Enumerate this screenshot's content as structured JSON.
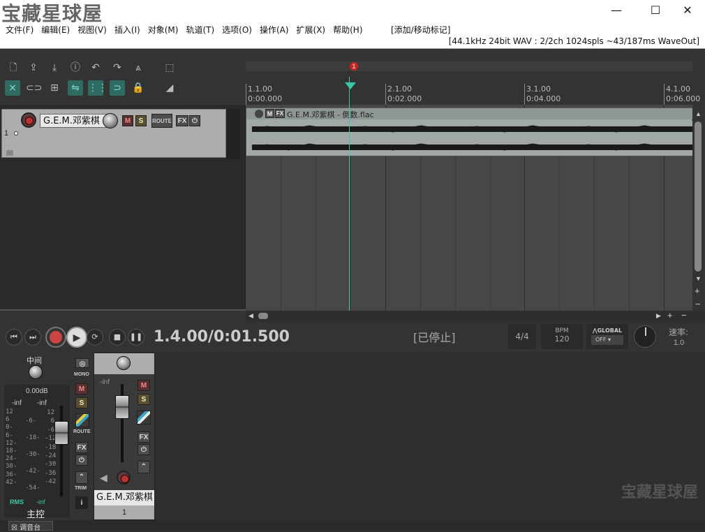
{
  "titlebar": {
    "watermark": "宝藏星球屋",
    "minimize": "—",
    "maximize": "☐",
    "close": "✕"
  },
  "menu": {
    "items": [
      "文件(F)",
      "编辑(E)",
      "视图(V)",
      "插入(I)",
      "对象(M)",
      "轨道(T)",
      "选项(O)",
      "操作(A)",
      "扩展(X)",
      "帮助(H)"
    ],
    "action": "[添加/移动标记]"
  },
  "status_info": "[44.1kHz 24bit WAV : 2/2ch 1024spls ~43/187ms WaveOut]",
  "ruler": {
    "marks": [
      {
        "bar": "1.1.00",
        "time": "0:00.000"
      },
      {
        "bar": "2.1.00",
        "time": "0:02.000"
      },
      {
        "bar": "3.1.00",
        "time": "0:04.000"
      },
      {
        "bar": "4.1.00",
        "time": "0:06.000"
      }
    ],
    "marker": "1"
  },
  "track": {
    "number": "1",
    "name": "G.E.M.邓紫棋",
    "mute": "M",
    "solo": "S",
    "route": "ROUTE",
    "fx": "FX"
  },
  "item": {
    "title": "G.E.M.邓紫棋 - 倒数.flac",
    "m": "M",
    "fx": "FX"
  },
  "transport": {
    "position": "1.4.00/0:01.500",
    "state": "[已停止]",
    "timesig": "4/4",
    "bpm_label": "BPM",
    "bpm": "120",
    "global_label": "GLOBAL",
    "global_value": "OFF",
    "rate_label": "速率:",
    "rate": "1.0"
  },
  "master": {
    "pan_label": "中间",
    "volume": "0.00dB",
    "peak_l": "-inf",
    "peak_r": "-inf",
    "scale_left": [
      "12",
      "6",
      "0-",
      "6-",
      "12-",
      "18-",
      "24-",
      "30-",
      "36-",
      "42-"
    ],
    "scale_mid": [
      "-6-",
      "-18-",
      "-30-",
      "-42-",
      "-54-"
    ],
    "scale_right": [
      "12",
      "6",
      "-6",
      "-12",
      "-18",
      "-24",
      "-30",
      "-36",
      "-42"
    ],
    "rms": "RMS",
    "rms_val": "-inf",
    "name": "主控",
    "mono": "MONO",
    "m": "M",
    "s": "S",
    "route": "ROUTE",
    "fx": "FX",
    "trim": "TRIM",
    "info": "i"
  },
  "channel": {
    "peak": "-inf",
    "m": "M",
    "s": "S",
    "fx": "FX",
    "name": "G.E.M.邓紫棋",
    "number": "1"
  },
  "bottom": {
    "tab": "调音台",
    "watermark": "宝藏星球屋"
  }
}
